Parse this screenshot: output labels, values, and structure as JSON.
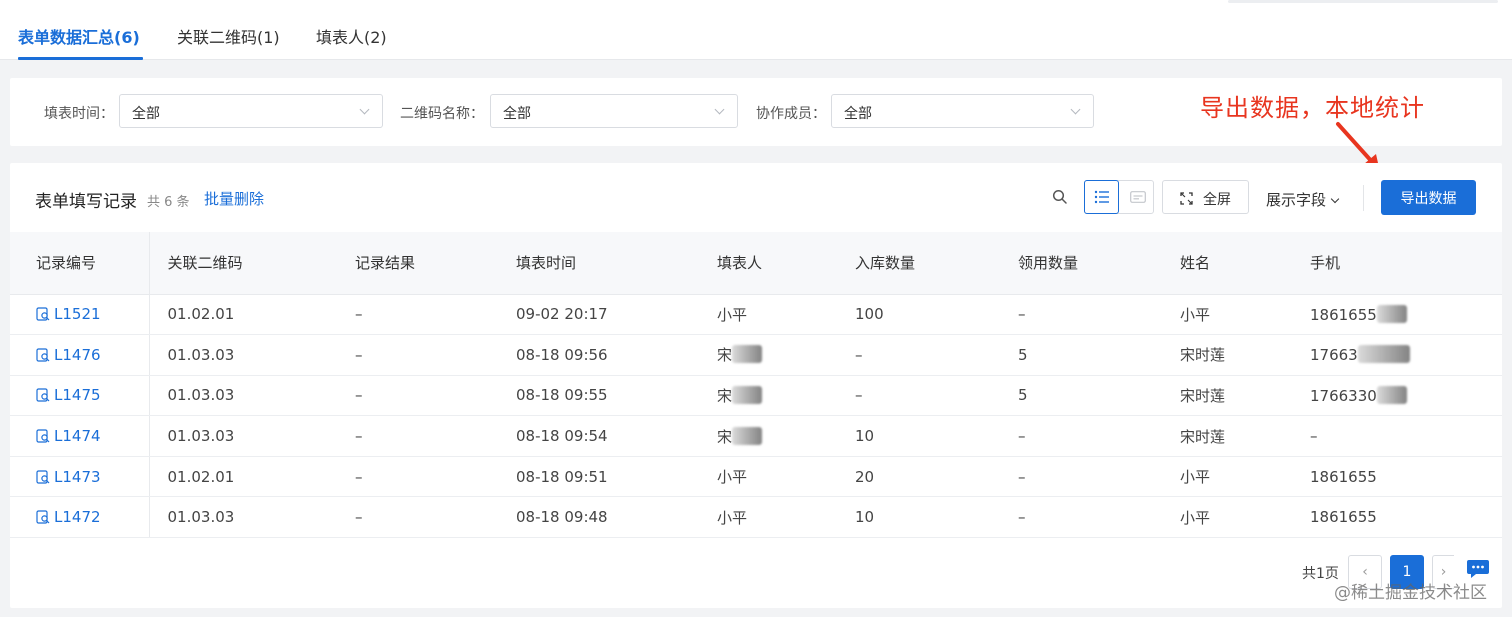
{
  "tabs": [
    {
      "label": "表单数据汇总(6)"
    },
    {
      "label": "关联二维码(1)"
    },
    {
      "label": "填表人(2)"
    }
  ],
  "filters": [
    {
      "label": "填表时间：",
      "value": "全部"
    },
    {
      "label": "二维码名称：",
      "value": "全部"
    },
    {
      "label": "协作成员：",
      "value": "全部"
    }
  ],
  "annotation": {
    "text": "导出数据，本地统计",
    "color": "#e8351f"
  },
  "card": {
    "title": "表单填写记录",
    "count": "共 6 条",
    "batch_delete": "批量删除",
    "fullscreen": "全屏",
    "show_fields": "展示字段",
    "export": "导出数据"
  },
  "table": {
    "headers": [
      "记录编号",
      "关联二维码",
      "记录结果",
      "填表时间",
      "填表人",
      "入库数量",
      "领用数量",
      "姓名",
      "手机"
    ],
    "rows": [
      [
        "L1521",
        "01.02.01",
        "–",
        "09-02 20:17",
        "小平",
        "100",
        "–",
        "小平",
        "1861655"
      ],
      [
        "L1476",
        "01.03.03",
        "–",
        "08-18 09:56",
        "宋",
        "–",
        "5",
        "宋时莲",
        "17663"
      ],
      [
        "L1475",
        "01.03.03",
        "–",
        "08-18 09:55",
        "宋",
        "–",
        "5",
        "宋时莲",
        "1766330"
      ],
      [
        "L1474",
        "01.03.03",
        "–",
        "08-18 09:54",
        "宋",
        "10",
        "–",
        "宋时莲",
        "–"
      ],
      [
        "L1473",
        "01.02.01",
        "–",
        "08-18 09:51",
        "小平",
        "20",
        "–",
        "小平",
        "1861655"
      ],
      [
        "L1472",
        "01.03.03",
        "–",
        "08-18 09:48",
        "小平",
        "10",
        "–",
        "小平",
        "1861655"
      ]
    ]
  },
  "pager": {
    "total": "共1页",
    "current": "1",
    "prev": "‹",
    "next": "›"
  },
  "watermark": "@稀土掘金技术社区",
  "colors": {
    "primary": "#1a6ed8",
    "annotation": "#e8351f"
  }
}
